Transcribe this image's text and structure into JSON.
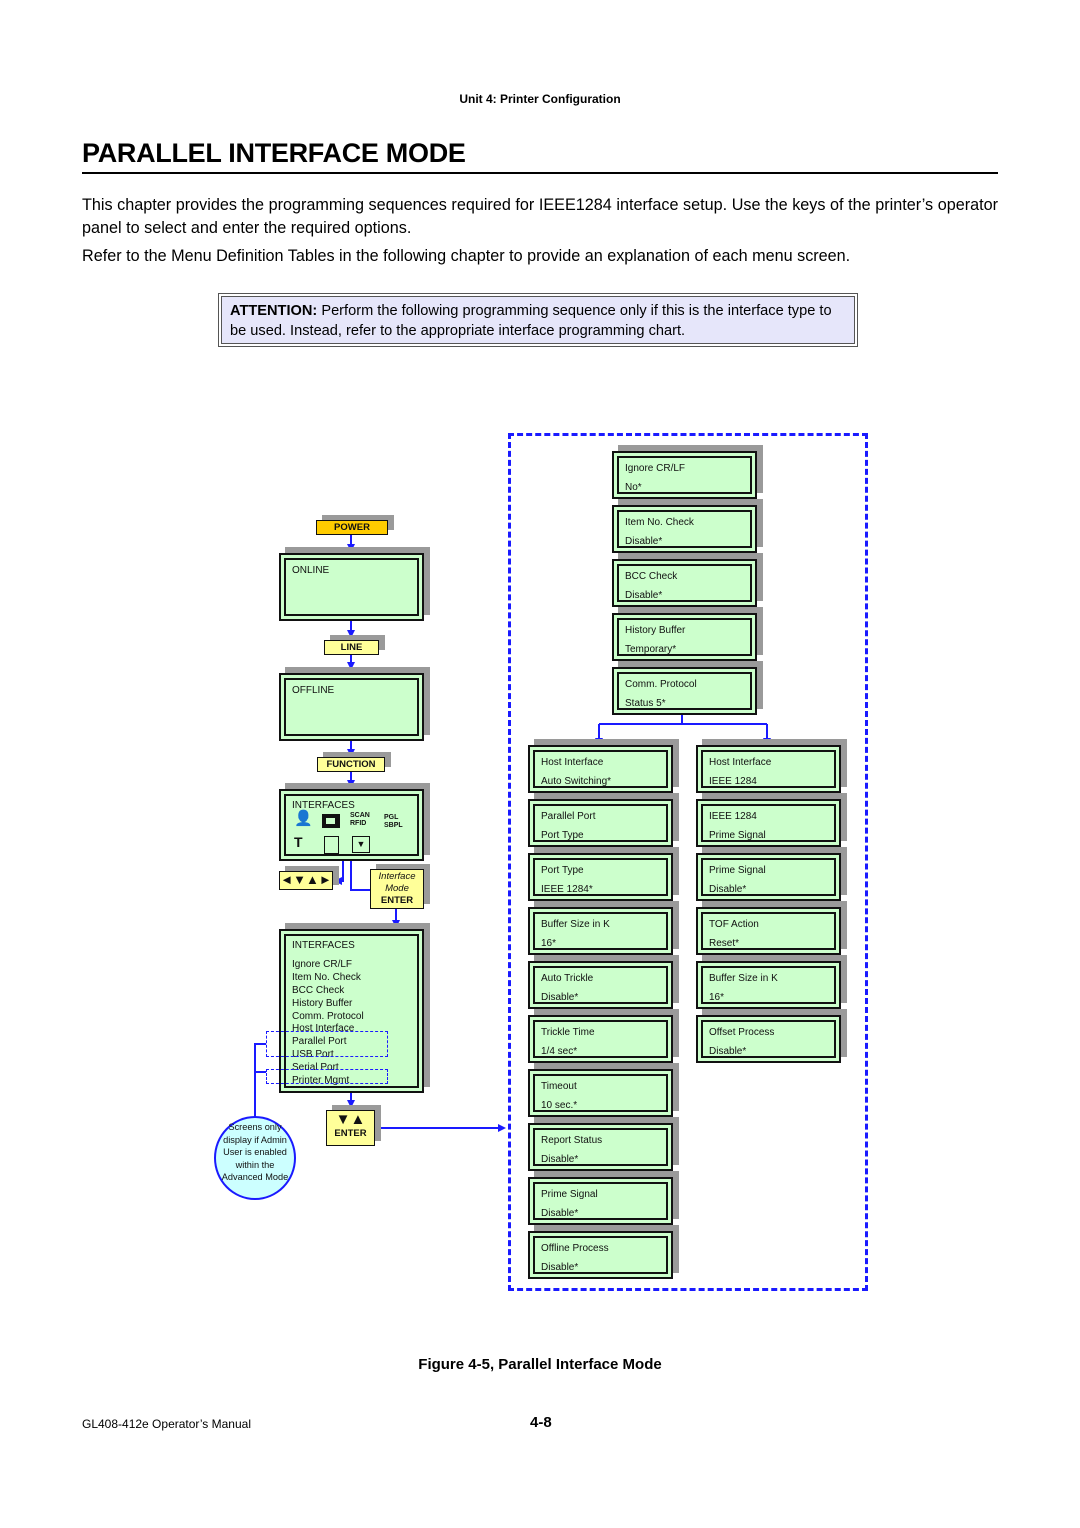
{
  "header": {
    "unit": "Unit 4:  Printer Configuration"
  },
  "title": "PARALLEL INTERFACE MODE",
  "paragraphs": [
    "This chapter provides the programming sequences required for IEEE1284 interface setup. Use the keys of the printer’s operator panel to select and enter the required options.",
    "Refer to the Menu Definition Tables in the following chapter to provide an explanation of each menu screen."
  ],
  "attention": {
    "label": "ATTENTION:",
    "text": " Perform the following programming sequence only if this is the interface type to be used. Instead, refer to the appropriate interface programming chart."
  },
  "keys": {
    "power": "POWER",
    "line": "LINE",
    "function": "FUNCTION",
    "nav_arrows": "◄▼▲►",
    "interface_mode_line1": "Interface",
    "interface_mode_line2": "Mode",
    "enter": "ENTER",
    "updown": "▼▲",
    "enter2": "ENTER"
  },
  "screens": {
    "online": "ONLINE",
    "offline": "OFFLINE",
    "interfaces_icons": {
      "title": "INTERFACES",
      "icons": [
        "user-icon",
        "interface-connector-icon",
        "scan-rfid-icon",
        "pgl-sbpl-icon",
        "tools-icon",
        "document-icon",
        "download-icon"
      ]
    },
    "interfaces_list": {
      "title": "INTERFACES",
      "items": [
        "Ignore CR/LF",
        "Item No. Check",
        "BCC Check",
        "History Buffer",
        "Comm. Protocol",
        "Host Interface",
        "Parallel Port",
        "USB Port",
        "Serial Port",
        "Printer Mgmt"
      ]
    }
  },
  "note": "Screens only display if Admin User is enabled within the Advanced Mode",
  "top_column": [
    {
      "name": "Ignore CR/LF",
      "value": "No*"
    },
    {
      "name": "Item No. Check",
      "value": "Disable*"
    },
    {
      "name": "BCC Check",
      "value": "Disable*"
    },
    {
      "name": "History Buffer",
      "value": "Temporary*"
    },
    {
      "name": "Comm. Protocol",
      "value": "Status 5*"
    }
  ],
  "left_column": [
    {
      "name": "Host Interface",
      "value": "Auto Switching*"
    },
    {
      "name": "Parallel Port",
      "value": "Port Type"
    },
    {
      "name": "Port Type",
      "value": "IEEE 1284*"
    },
    {
      "name": "Buffer Size in K",
      "value": "16*"
    },
    {
      "name": "Auto Trickle",
      "value": "Disable*"
    },
    {
      "name": "Trickle Time",
      "value": "1/4 sec*"
    },
    {
      "name": "Timeout",
      "value": "10 sec.*"
    },
    {
      "name": "Report Status",
      "value": "Disable*"
    },
    {
      "name": "Prime Signal",
      "value": "Disable*"
    },
    {
      "name": "Offline Process",
      "value": "Disable*"
    }
  ],
  "right_column": [
    {
      "name": "Host Interface",
      "value": "IEEE 1284"
    },
    {
      "name": "IEEE 1284",
      "value": "Prime Signal"
    },
    {
      "name": "Prime Signal",
      "value": "Disable*"
    },
    {
      "name": "TOF Action",
      "value": "Reset*"
    },
    {
      "name": "Buffer Size in K",
      "value": "16*"
    },
    {
      "name": "Offset Process",
      "value": "Disable*"
    }
  ],
  "figure_caption": "Figure 4-5, Parallel Interface Mode",
  "footer": {
    "manual": "GL408-412e Operator’s Manual",
    "page": "4-8"
  }
}
